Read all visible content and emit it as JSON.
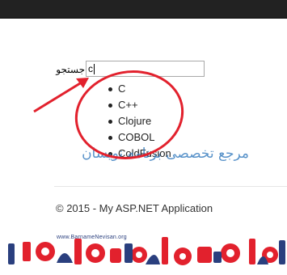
{
  "search": {
    "label": "جستجو",
    "value": "c"
  },
  "autocomplete": {
    "items": [
      "C",
      "C++",
      "Clojure",
      "COBOL",
      "ColdFusion"
    ]
  },
  "footer": {
    "text": "© 2015 - My ASP.NET Application"
  },
  "watermark": {
    "text": "مرجع تخصصی برنامه نویسان",
    "logo_url": "www.BarnameNevisan.org"
  },
  "colors": {
    "navbar": "#222222",
    "annotation": "#e2212d",
    "watermark": "#3b7fc0",
    "logo_red": "#e2212d",
    "logo_navy": "#2a3f7e"
  }
}
